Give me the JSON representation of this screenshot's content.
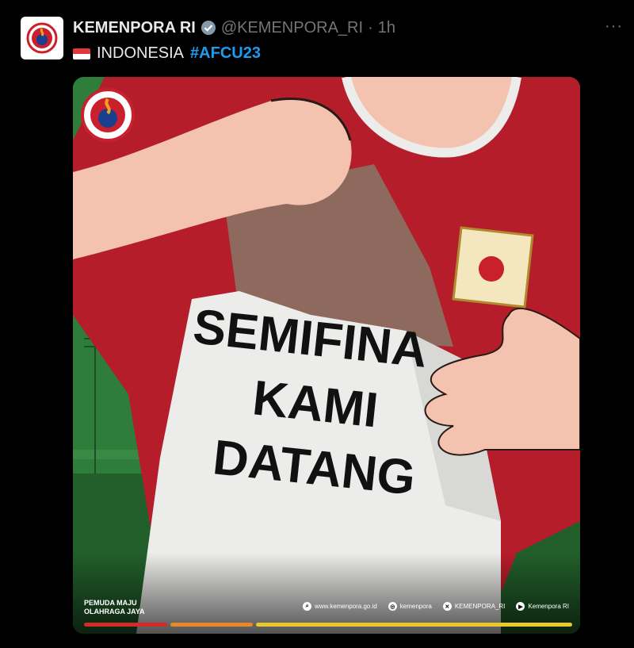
{
  "post": {
    "display_name": "KEMENPORA RI",
    "handle": "@KEMENPORA_RI",
    "separator": "·",
    "time": "1h",
    "more": "···",
    "text_prefix": "INDONESIA",
    "hashtag": "#AFCU23"
  },
  "media": {
    "headline_lines": [
      "SEMIFINA",
      "KAMI",
      "DATANG"
    ],
    "slogan_line1": "PEMUDA MAJU",
    "slogan_line2": "OLAHRAGA JAYA",
    "contacts": [
      {
        "icon": "search-icon",
        "label": "www.kemenpora.go.id"
      },
      {
        "icon": "instagram-icon",
        "label": "kemenpora"
      },
      {
        "icon": "x-icon",
        "label": "KEMENPORA_RI"
      },
      {
        "icon": "youtube-facebook-icon",
        "label": "Kemenpora RI"
      }
    ]
  },
  "colors": {
    "accent": "#1d9bf0",
    "flag_red": "#e0383e",
    "flag_white": "#ffffff",
    "grass": "#2f7d3a",
    "jersey_red": "#b51d2b",
    "shirt_white": "#ececea",
    "skin": "#f3c3b0",
    "bar_red": "#d42a2a",
    "bar_orange": "#e8862a",
    "bar_yellow": "#e8c82a"
  }
}
